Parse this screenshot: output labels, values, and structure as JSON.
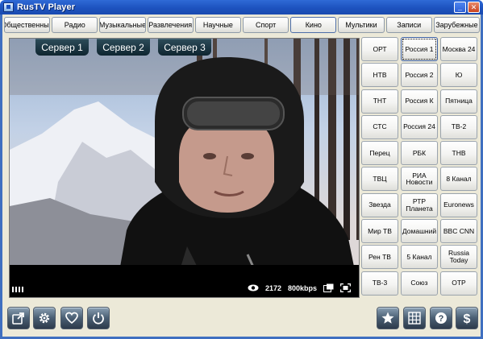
{
  "window": {
    "title": "RusTV Player"
  },
  "categories": [
    {
      "label": "Общественные"
    },
    {
      "label": "Радио"
    },
    {
      "label": "Музыкальные"
    },
    {
      "label": "Развлечения"
    },
    {
      "label": "Научные"
    },
    {
      "label": "Спорт"
    },
    {
      "label": "Кино"
    },
    {
      "label": "Мультики"
    },
    {
      "label": "Записи"
    },
    {
      "label": "Зарубежные"
    }
  ],
  "player": {
    "servers": [
      "Сервер 1",
      "Сервер 2",
      "Сервер 3"
    ],
    "viewers": "2172",
    "bitrate": "800kbps"
  },
  "channels": [
    "ОРТ",
    "Россия 1",
    "Москва 24",
    "НТВ",
    "Россия 2",
    "Ю",
    "ТНТ",
    "Россия К",
    "Пятница",
    "СТС",
    "Россия 24",
    "ТВ-2",
    "Перец",
    "РБК",
    "ТНВ",
    "ТВЦ",
    "РИА Новости",
    "8 Канал",
    "Звезда",
    "РТР Планета",
    "Euronews",
    "Мир ТВ",
    "Домашний",
    "BBC CNN",
    "Рен ТВ",
    "5 Канал",
    "Russia Today",
    "ТВ-3",
    "Союз",
    "ОТР"
  ],
  "selected_channel": "Россия 1",
  "bottom_buttons_left": [
    "share-icon",
    "settings-gear-icon",
    "heart-icon",
    "power-icon"
  ],
  "bottom_buttons_right": [
    "star-icon",
    "grid-icon",
    "help-icon",
    "dollar-icon"
  ],
  "colors": {
    "titlebar": "#1d52bf",
    "server_tab": "#1b3542",
    "button_face": "#4a5e73"
  }
}
